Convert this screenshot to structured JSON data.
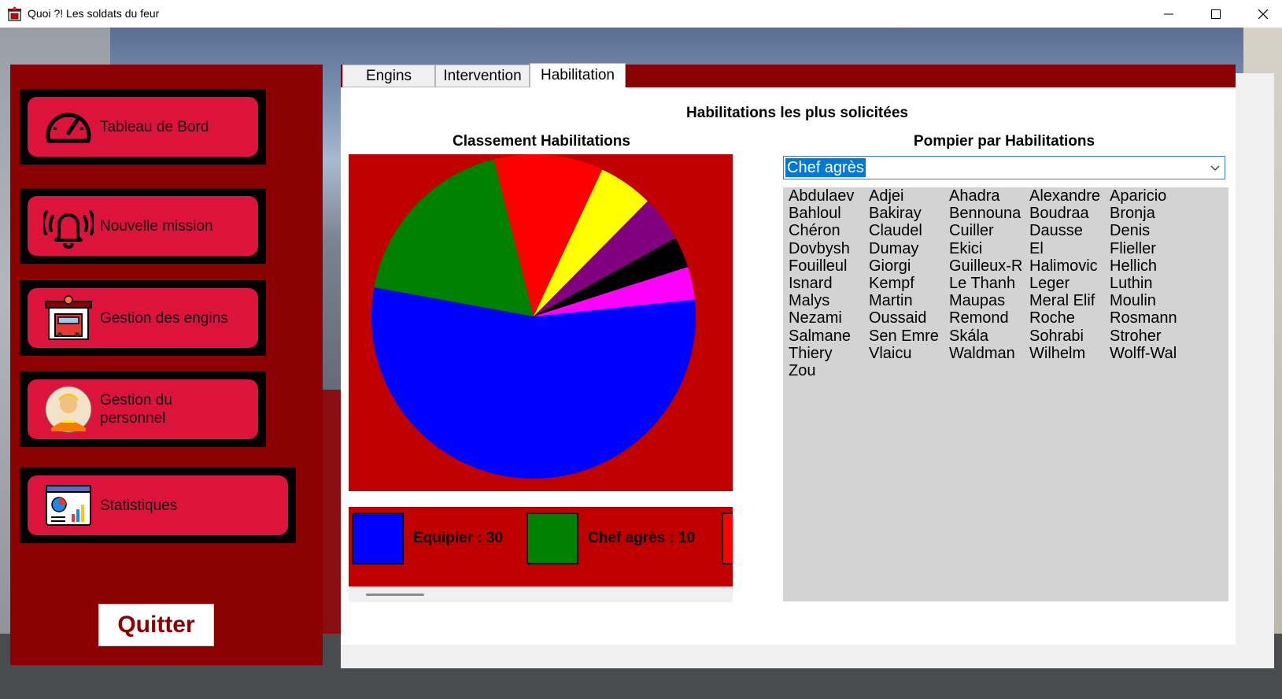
{
  "window": {
    "title": "Quoi ?!  Les soldats du feur",
    "controls": {
      "minimize": "minimize-icon",
      "maximize": "maximize-icon",
      "close": "close-icon"
    }
  },
  "nav": {
    "items": [
      {
        "label": "Tableau de Bord",
        "icon": "gauge-icon"
      },
      {
        "label": "Nouvelle mission",
        "icon": "alarm-bell-icon"
      },
      {
        "label": "Gestion des engins",
        "icon": "fire-station-icon"
      },
      {
        "label": "Gestion du\npersonnel",
        "icon": "firefighter-avatar-icon"
      },
      {
        "label": "Statistiques",
        "icon": "statistics-dashboard-icon"
      }
    ],
    "quit_label": "Quitter"
  },
  "tabs": [
    {
      "label": "Engins",
      "active": false
    },
    {
      "label": "Intervention",
      "active": false
    },
    {
      "label": "Habilitation",
      "active": true
    }
  ],
  "habilitation": {
    "title": "Habilitations les plus solicitées",
    "chart_title": "Classement Habilitations",
    "list_title": "Pompier par Habilitations",
    "selected_habilitation": "Chef agrès",
    "legend": [
      {
        "text": "Equipier : 30",
        "color": "#0000ff"
      },
      {
        "text": "Chef agrès : 10",
        "color": "#008000"
      }
    ],
    "names": [
      "Abdulaev",
      "Adjei",
      "Ahadra",
      "Alexandre",
      "Aparicio",
      "Bahloul",
      "Bakiray",
      "Bennouna",
      "Boudraa",
      "Bronja",
      "Chéron",
      "Claudel",
      "Cuiller",
      "Dausse",
      "Denis",
      "Dovbysh",
      "Dumay",
      "Ekici",
      "El",
      "Flieller",
      "Fouilleul",
      "Giorgi",
      "Guilleux-R",
      "Halimovic",
      "Hellich",
      "Isnard",
      "Kempf",
      "Le Thanh",
      "Leger",
      "Luthin",
      "Malys",
      "Martin",
      "Maupas",
      "Meral Elif",
      "Moulin",
      "Nezami",
      "Oussaid",
      "Remond",
      "Roche",
      "Rosmann",
      "Salmane",
      "Sen Emre",
      "Skála",
      "Sohrabi",
      "Stroher",
      "Thiery",
      "Vlaicu",
      "Waldman",
      "Wilhelm",
      "Wolff-Wal",
      "Zou"
    ]
  },
  "chart_data": {
    "type": "pie",
    "title": "Classement Habilitations",
    "slices": [
      {
        "label": "Equipier",
        "value": 30,
        "color": "#0000ff"
      },
      {
        "label": "Chef agrès",
        "value": 10,
        "color": "#008000"
      },
      {
        "label": "",
        "value": 6,
        "color": "#ff0000"
      },
      {
        "label": "",
        "value": 3,
        "color": "#ffff00"
      },
      {
        "label": "",
        "value": 2.5,
        "color": "#800080"
      },
      {
        "label": "",
        "value": 1.7,
        "color": "#000000"
      },
      {
        "label": "",
        "value": 1.8,
        "color": "#ff00ff"
      }
    ]
  }
}
